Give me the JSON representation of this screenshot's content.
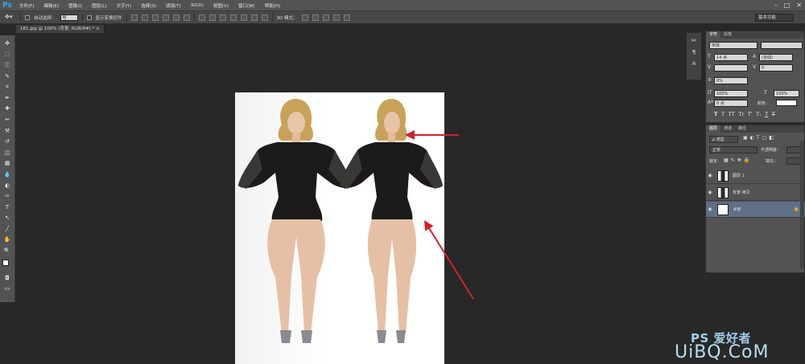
{
  "app": {
    "logo": "Ps"
  },
  "menu": [
    "文件(F)",
    "编辑(E)",
    "图像(I)",
    "图层(L)",
    "文字(Y)",
    "选择(S)",
    "滤镜(T)",
    "3D(D)",
    "视图(V)",
    "窗口(W)",
    "帮助(H)"
  ],
  "window_controls": {
    "minimize": "–",
    "maximize": "□",
    "close": "✕"
  },
  "options": {
    "auto_select_label": "自动选择：",
    "auto_select_value": "组",
    "show_transform_label": "显示变换控件",
    "mode_3d_label": "3D 模式：",
    "workspace": "基本功能"
  },
  "document": {
    "tab_title": "181.jpg @ 100% (背景, RGB/8#) *",
    "close": "×"
  },
  "tools": [
    "move",
    "marquee",
    "lasso",
    "quick-select",
    "crop",
    "eyedropper",
    "healing",
    "brush",
    "stamp",
    "history-brush",
    "eraser",
    "gradient",
    "blur",
    "dodge",
    "pen",
    "type",
    "path-select",
    "shape",
    "hand",
    "zoom"
  ],
  "tool_glyphs": [
    "✥",
    "⬚",
    "ⓛ",
    "✎",
    "⌗",
    "✒",
    "✚",
    "✏",
    "⚒",
    "↺",
    "◫",
    "▦",
    "💧",
    "◐",
    "✑",
    "T",
    "↖",
    "╱",
    "✋",
    "🔍"
  ],
  "char_panel": {
    "tabs": [
      "字符",
      "段落"
    ],
    "font_family": "宋体",
    "font_size": "14 点",
    "leading": "(自动)",
    "tracking": "0",
    "scale_pct": "0%",
    "vscale": "100%",
    "hscale": "100%",
    "baseline": "0 点",
    "color_label": "颜色：",
    "glyphs": [
      "T",
      "T",
      "TT",
      "Tr",
      "T'",
      "T₁",
      "T",
      "T"
    ]
  },
  "layers_panel": {
    "tabs": [
      "图层",
      "通道",
      "路径"
    ],
    "kind_filter": "ρ 类型",
    "blend_mode": "正常",
    "opacity_label": "不透明度：",
    "lock_label": "锁定：",
    "fill_label": "填充：",
    "layers": [
      {
        "name": "图层 1",
        "selected": false
      },
      {
        "name": "背景 拷贝",
        "selected": false
      },
      {
        "name": "背景",
        "selected": true
      }
    ]
  },
  "watermark": {
    "line1": "PS 爱好者",
    "line2": "UiBQ.CoM"
  },
  "colors": {
    "arrow": "#d4202a",
    "selected_layer": "#5e6f87"
  }
}
